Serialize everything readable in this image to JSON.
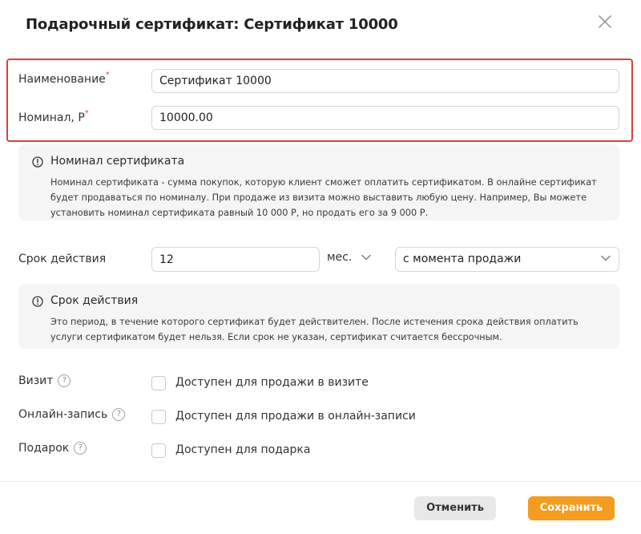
{
  "dialog": {
    "title": "Подарочный сертификат: Сертификат 10000"
  },
  "fields": {
    "name": {
      "label": "Наименование",
      "required_mark": "*",
      "value": "Сертификат 10000"
    },
    "nominal": {
      "label": "Номинал, Р",
      "required_mark": "*",
      "value": "10000.00"
    }
  },
  "info_nominal": {
    "title": "Номинал сертификата",
    "text": "Номинал сертификата - сумма покупок, которую клиент сможет оплатить сертификатом. В онлайне сертификат будет продаваться по номиналу. При продаже из визита можно выставить любую цену. Например, Вы можете установить номинал сертификата равный 10 000 Р, но продать его за 9 000 Р."
  },
  "validity": {
    "label": "Срок действия",
    "value": "12",
    "unit": "мес.",
    "start": "с момента продажи"
  },
  "info_validity": {
    "title": "Срок действия",
    "text": "Это период, в течение которого сертификат будет действителен. После истечения срока действия оплатить услуги сертификатом будет нельзя. Если срок не указан, сертификат считается бессрочным."
  },
  "availability": [
    {
      "label": "Визит",
      "help": "?",
      "checkbox_label": "Доступен для продажи в визите",
      "checked": false
    },
    {
      "label": "Онлайн-запись",
      "help": "?",
      "checkbox_label": "Доступен для продажи в онлайн-записи",
      "checked": false
    },
    {
      "label": "Подарок",
      "help": "?",
      "checkbox_label": "Доступен для подарка",
      "checked": false
    }
  ],
  "footer": {
    "cancel_label": "Отменить",
    "save_label": "Сохранить"
  },
  "colors": {
    "accent": "#f39c1f",
    "highlight": "#d9413a",
    "required": "#e84a4a"
  },
  "icons": {
    "close": "close-icon",
    "info": "info-circle-icon",
    "chevron": "chevron-down-icon",
    "help": "help-circle-icon"
  }
}
